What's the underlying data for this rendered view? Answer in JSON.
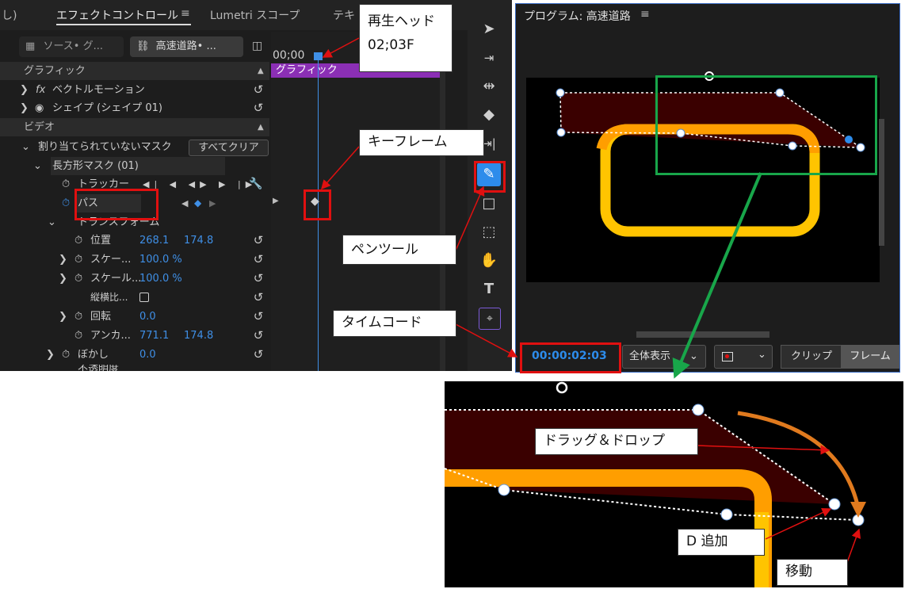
{
  "tabs": {
    "left_cut": "し)",
    "effect_controls": "エフェクトコントロール",
    "menu": "≡",
    "lumetri": "Lumetri スコープ",
    "text_cut": "テキ"
  },
  "source": {
    "src_label": "ソース• グ...",
    "seq_label": "高速道路• ..."
  },
  "sections": {
    "graphic": "グラフィック",
    "video": "ビデオ"
  },
  "rows": {
    "vector_motion": "ベクトルモーション",
    "shape": "シェイプ (シェイプ 01)",
    "unassigned_mask": "割り当てられていないマスク",
    "clear_all": "すべてクリア",
    "rect_mask": "長方形マスク (01)",
    "tracker": "トラッカー",
    "path": "パス",
    "transform": "トランスフォーム",
    "position": "位置",
    "position_x": "268.1",
    "position_y": "174.8",
    "scale": "スケー...",
    "scale_val": "100.0 %",
    "scale_w": "スケール...",
    "scale_w_val": "100.0 %",
    "aspect": "縦横比...",
    "rotation": "回転",
    "rotation_val": "0.0",
    "anchor": "アンカ...",
    "anchor_x": "771.1",
    "anchor_y": "174.8",
    "blur": "ぼかし",
    "blur_val": "0.0",
    "opacity_cut": "不透明度"
  },
  "timeline": {
    "timecode": "00;00",
    "clip": "グラフィック"
  },
  "program": {
    "title": "プログラム: 高速道路",
    "menu": "≡",
    "timecode": "00:00:02:03",
    "fit": "全体表示",
    "clip_btn": "クリップ",
    "frame_btn": "フレーム"
  },
  "callouts": {
    "playhead_line1": "再生ヘッド",
    "playhead_line2": "02;03F",
    "keyframe": "キーフレーム",
    "pen_tool": "ペンツール",
    "timecode": "タイムコード",
    "drag_drop": "ドラッグ＆ドロップ",
    "add_d": "D 追加",
    "move": "移動"
  },
  "colors": {
    "accent": "#2d8ceb",
    "mask_fill": "#3a0000",
    "road": "#ff9e00",
    "road_yellow": "#ffc400",
    "annotation_red": "#e01010",
    "annotation_green": "#18a64a",
    "arrow_orange": "#e07a1e"
  }
}
